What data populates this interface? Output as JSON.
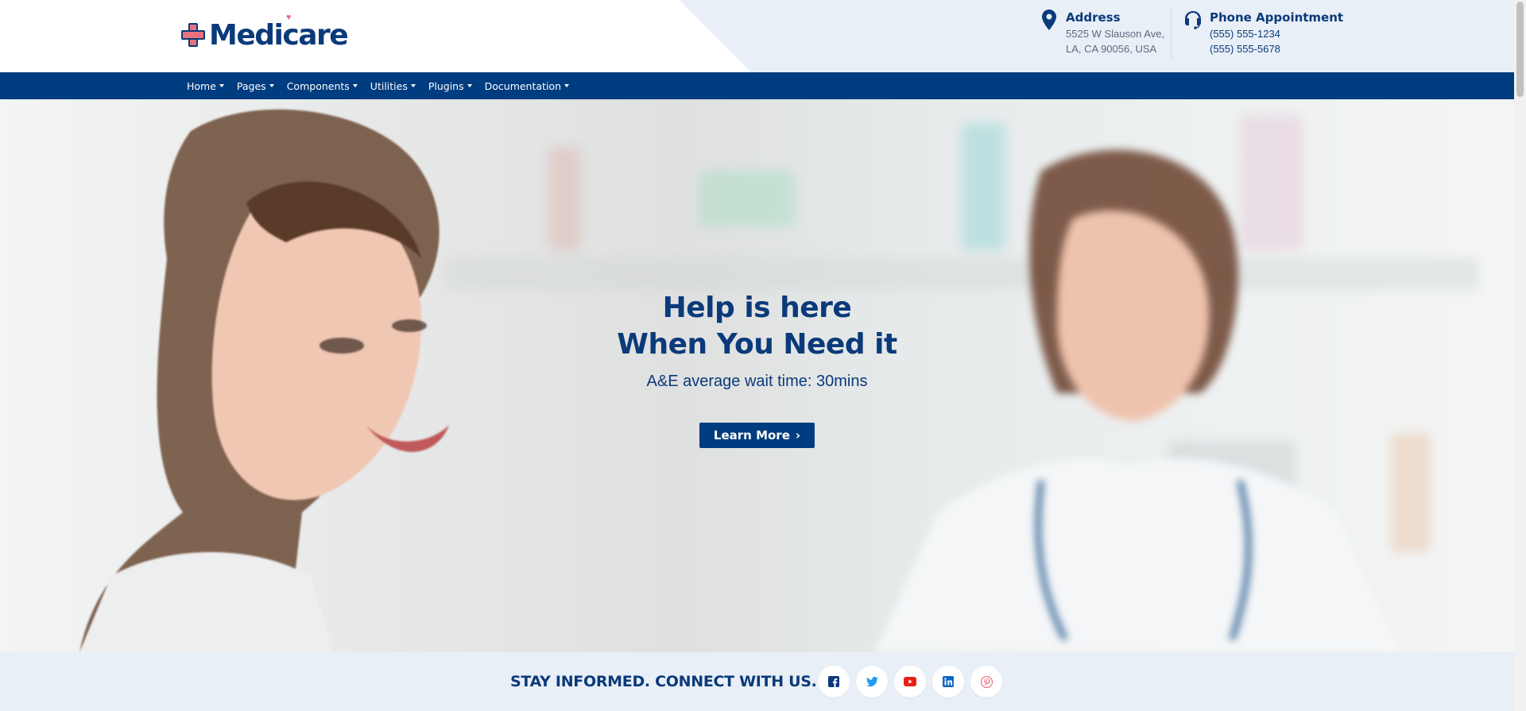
{
  "brand": {
    "name": "Medicare",
    "accent": "#0a3a7a",
    "cross_color": "#e9707f"
  },
  "contact": {
    "address": {
      "title": "Address",
      "line1": "5525 W Slauson Ave,",
      "line2": "LA, CA 90056, USA"
    },
    "phone": {
      "title": "Phone Appointment",
      "line1": "(555) 555-1234",
      "line2": "(555) 555-5678"
    }
  },
  "nav": {
    "items": [
      {
        "label": "Home"
      },
      {
        "label": "Pages"
      },
      {
        "label": "Components"
      },
      {
        "label": "Utilities"
      },
      {
        "label": "Plugins"
      },
      {
        "label": "Documentation"
      }
    ],
    "background": "#003d80"
  },
  "hero": {
    "title_line1": "Help is here",
    "title_line2": "When You Need it",
    "subtitle": "A&E average wait time: 30mins",
    "button_label": "Learn More"
  },
  "social": {
    "title": "STAY INFORMED. CONNECT WITH US.",
    "icons": [
      {
        "name": "facebook-icon",
        "glyph": "f",
        "color": "#0a3a7a"
      },
      {
        "name": "twitter-icon",
        "glyph": "t",
        "color": "#1d9bf0"
      },
      {
        "name": "youtube-icon",
        "glyph": "▶",
        "color": "#e62117"
      },
      {
        "name": "linkedin-icon",
        "glyph": "in",
        "color": "#0a66c2"
      },
      {
        "name": "pinterest-icon",
        "glyph": "p",
        "color": "#e9707f"
      }
    ]
  }
}
